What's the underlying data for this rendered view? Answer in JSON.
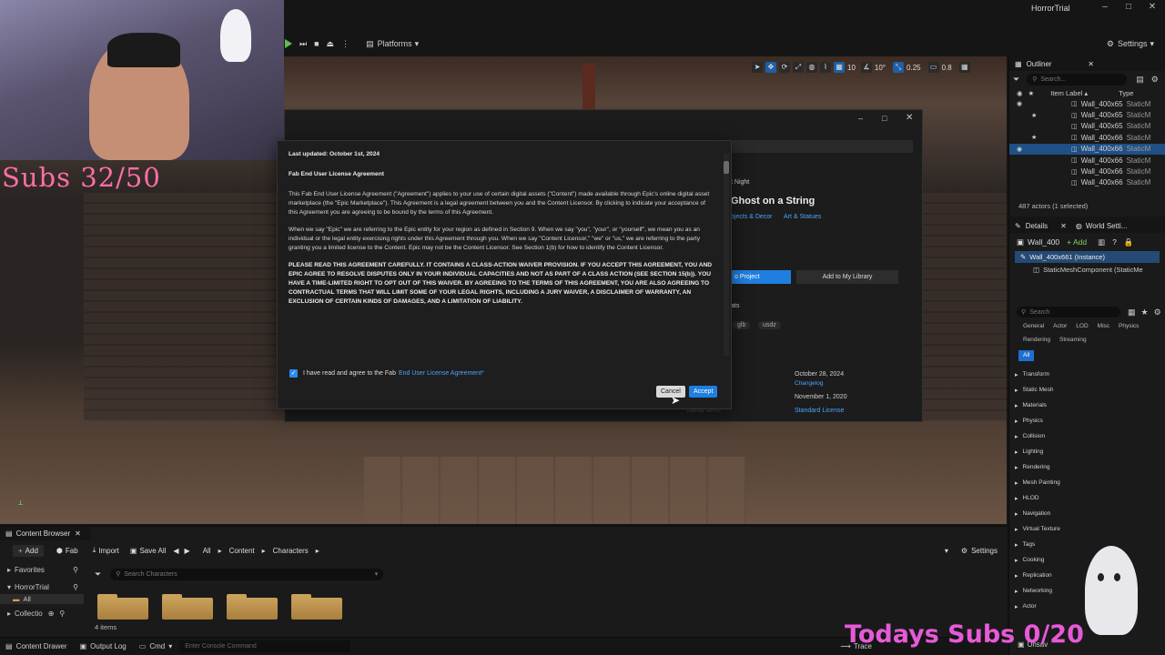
{
  "window": {
    "title": "HorrorTrial"
  },
  "toolbar": {
    "platforms_label": "Platforms",
    "settings_label": "Settings"
  },
  "viewport_tools": {
    "grid": "10",
    "rot": "10°",
    "scale": "0.25",
    "camera": "0.8"
  },
  "overlay": {
    "subs_left": "Subs 32/50",
    "subs_bottom": "Todays Subs 0/20"
  },
  "fab": {
    "breadcrumb_partial": "t Night",
    "asset_title": "Ghost on a String",
    "category": "bjects & Decor",
    "subcategory": "Art & Statues",
    "project_btn": "o Project",
    "library_btn": "Add to My Library",
    "formats_label": "ats",
    "formats": [
      "glb",
      "usdz"
    ],
    "date1": "October 28, 2024",
    "changelog": "Changelog",
    "date2": "November 1, 2020",
    "license": "Standard License",
    "license_terms": "icense terms"
  },
  "dialog": {
    "last_updated": "Last updated: October 1st, 2024",
    "heading": "Fab End User License Agreement",
    "para1": "This Fab End User License Agreement (\"Agreement\") applies to your use of certain digital assets (\"Content\") made available through Epic's online digital asset marketplace (the \"Epic Marketplace\"). This Agreement is a legal agreement between you and the Content Licensor. By clicking to indicate your acceptance of this Agreement you are agreeing to be bound by the terms of this Agreement.",
    "para2": "When we say \"Epic\" we are referring to the Epic entity for your region as defined in Section 9. When we say \"you\", \"your\", or \"yourself\", we mean you as an individual or the legal entity exercising rights under this Agreement through you. When we say \"Content Licensor,\" \"we\" or \"us,\" we are referring to the party granting you a limited license to the Content. Epic may not be the Content Licensor. See Section 1(b) for how to identify the Content Licensor.",
    "para3": "PLEASE READ THIS AGREEMENT CAREFULLY. IT CONTAINS A CLASS-ACTION WAIVER PROVISION. IF YOU ACCEPT THIS AGREEMENT, YOU AND EPIC AGREE TO RESOLVE DISPUTES ONLY IN YOUR INDIVIDUAL CAPACITIES AND NOT AS PART OF A CLASS ACTION (SEE SECTION 15(b)). YOU HAVE A TIME-LIMITED RIGHT TO OPT OUT OF THIS WAIVER. BY AGREEING TO THE TERMS OF THIS AGREEMENT, YOU ARE ALSO AGREEING TO CONTRACTUAL TERMS THAT WILL LIMIT SOME OF YOUR LEGAL RIGHTS, INCLUDING A JURY WAIVER, A DISCLAIMER OF WARRANTY, AN EXCLUSION OF CERTAIN KINDS OF DAMAGES, AND A LIMITATION OF LIABILITY.",
    "agree_text": "I have read and agree to the Fab",
    "agree_link": "End User License Agreement",
    "agree_star": "*",
    "cancel": "Cancel",
    "accept": "Accept"
  },
  "outliner": {
    "tab": "Outliner",
    "search_placeholder": "Search...",
    "col_label": "Item Label ▴",
    "col_type": "Type",
    "items": [
      {
        "label": "Wall_400x65",
        "type": "StaticM"
      },
      {
        "label": "Wall_400x65",
        "type": "StaticM"
      },
      {
        "label": "Wall_400x65",
        "type": "StaticM"
      },
      {
        "label": "Wall_400x66",
        "type": "StaticM"
      },
      {
        "label": "Wall_400x66",
        "type": "StaticM"
      },
      {
        "label": "Wall_400x66",
        "type": "StaticM"
      },
      {
        "label": "Wall_400x66",
        "type": "StaticM"
      },
      {
        "label": "Wall_400x66",
        "type": "StaticM"
      }
    ],
    "selected_index": 4,
    "status": "487 actors (1 selected)"
  },
  "details": {
    "tab": "Details",
    "tab2": "World Setti...",
    "name": "Wall_400",
    "add": "+ Add",
    "instance": "Wall_400x661 (Instance)",
    "component": "StaticMeshComponent (StaticMe",
    "search_placeholder": "Search",
    "filters": [
      "General",
      "Actor",
      "LOD",
      "Misc",
      "Physics",
      "Rendering",
      "Streaming"
    ],
    "all": "All",
    "sections": [
      "Transform",
      "Static Mesh",
      "Materials",
      "Physics",
      "Collision",
      "Lighting",
      "Rendering",
      "Mesh Painting",
      "HLOD",
      "Navigation",
      "Virtual Texture",
      "Tags",
      "Cooking",
      "Replication",
      "Networking",
      "Actor"
    ]
  },
  "content_browser": {
    "tab": "Content Browser",
    "add": "Add",
    "fab": "Fab",
    "import": "Import",
    "save_all": "Save All",
    "path": [
      "All",
      "Content",
      "Characters"
    ],
    "settings": "Settings",
    "favorites": "Favorites",
    "project": "HorrorTrial",
    "all": "All",
    "collections": "Collectio",
    "search_placeholder": "Search Characters",
    "count": "4 items",
    "folders": 4
  },
  "statusbar": {
    "drawer": "Content Drawer",
    "output": "Output Log",
    "cmd": "Cmd",
    "console_placeholder": "Enter Console Command",
    "trace": "Trace",
    "unsaved": "Unsav"
  }
}
